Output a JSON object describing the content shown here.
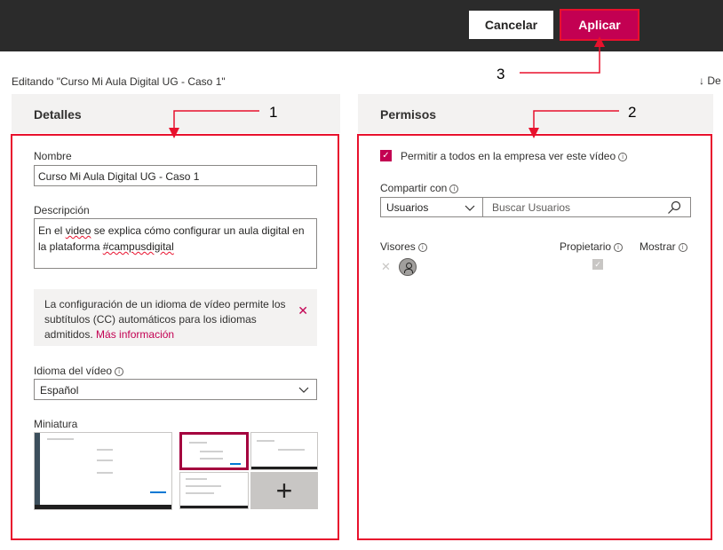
{
  "toolbar": {
    "cancel_label": "Cancelar",
    "apply_label": "Aplicar"
  },
  "editing_label": "Editando \"Curso Mi Aula Digital UG - Caso 1\"",
  "download_label": "De",
  "details": {
    "header": "Detalles",
    "name_label": "Nombre",
    "name_value": "Curso Mi Aula Digital UG - Caso 1",
    "description_label": "Descripción",
    "description_pre": "En el ",
    "description_underlined": "video",
    "description_mid": " se explica cómo configurar un aula digital en la plataforma ",
    "description_tag": "#campusdigital",
    "info_text": "La configuración de un idioma de vídeo permite los subtítulos (CC) automáticos para los idiomas admitidos.",
    "info_link": "Más información",
    "language_label": "Idioma del vídeo",
    "language_value": "Español",
    "thumbnail_label": "Miniatura"
  },
  "permissions": {
    "header": "Permisos",
    "allow_all_label": "Permitir a todos en la empresa ver este vídeo",
    "allow_all_checked": true,
    "share_with_label": "Compartir con",
    "share_with_value": "Usuarios",
    "search_placeholder": "Buscar Usuarios",
    "col_viewers": "Visores",
    "col_owner": "Propietario",
    "col_show": "Mostrar"
  },
  "callouts": [
    "1",
    "2",
    "3"
  ],
  "colors": {
    "accent": "#c30052",
    "callout_red": "#e8112d",
    "topbar": "#2b2b2b"
  }
}
